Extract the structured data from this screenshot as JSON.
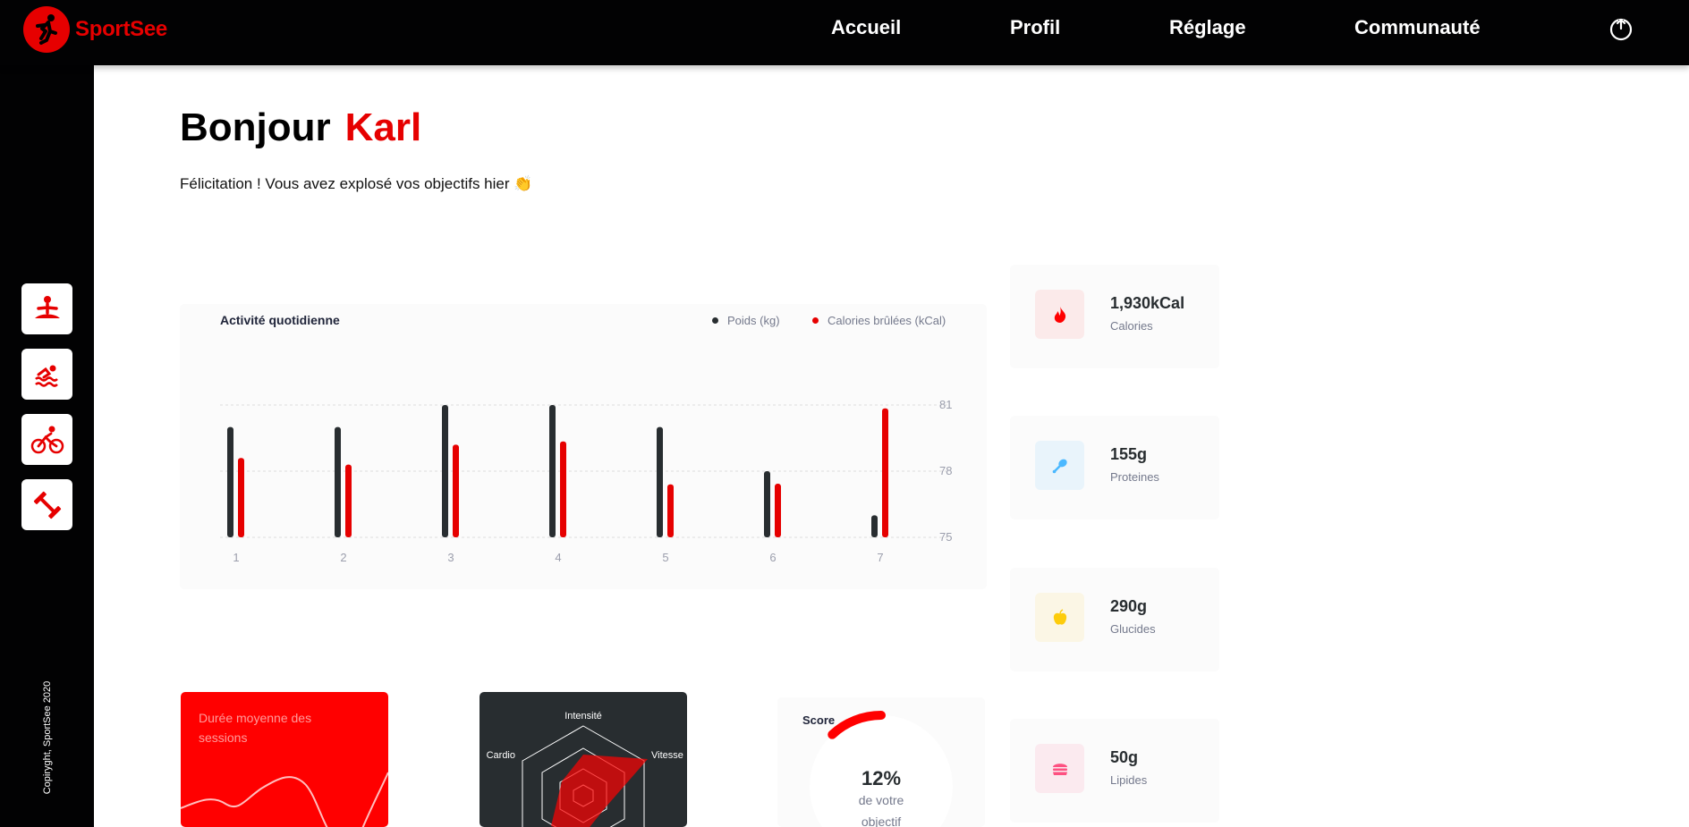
{
  "app": {
    "name": "SportSee"
  },
  "nav": {
    "items": [
      "Accueil",
      "Profil",
      "Réglage",
      "Communauté"
    ]
  },
  "sidebar": {
    "items": [
      {
        "icon": "yoga-icon"
      },
      {
        "icon": "swim-icon"
      },
      {
        "icon": "bike-icon"
      },
      {
        "icon": "dumbbell-icon"
      }
    ],
    "copyright": "Copiryght, SportSee 2020"
  },
  "header": {
    "greeting": "Bonjour",
    "name": "Karl",
    "congrats": "Félicitation ! Vous avez explosé vos objectifs hier 👏"
  },
  "activity": {
    "title": "Activité quotidienne",
    "legend": [
      "Poids (kg)",
      "Calories brûlées (kCal)"
    ],
    "colors": {
      "weight": "#282d30",
      "calories": "#e60000"
    }
  },
  "kpis": [
    {
      "value": "1,930kCal",
      "label": "Calories",
      "icon": "fire-icon",
      "bg": "#fbeaea",
      "color": "#ff0000"
    },
    {
      "value": "155g",
      "label": "Proteines",
      "icon": "chicken-icon",
      "bg": "#e9f4fb",
      "color": "#4ab8ff"
    },
    {
      "value": "290g",
      "label": "Glucides",
      "icon": "apple-icon",
      "bg": "#fbf6e5",
      "color": "#fdcc0c"
    },
    {
      "value": "50g",
      "label": "Lipides",
      "icon": "burger-icon",
      "bg": "#fbeaef",
      "color": "#fd5181"
    }
  ],
  "session": {
    "title": "Durée moyenne des sessions"
  },
  "radar": {
    "labels": [
      "Intensité",
      "Vitesse",
      "Cardio"
    ]
  },
  "score": {
    "title": "Score",
    "percent": "12%",
    "line1": "de votre",
    "line2": "objectif",
    "value": 0.12
  },
  "chart_data": {
    "type": "bar",
    "categories": [
      "1",
      "2",
      "3",
      "4",
      "5",
      "6",
      "7"
    ],
    "series": [
      {
        "name": "Poids (kg)",
        "values": [
          80,
          80,
          81,
          81,
          80,
          78,
          76
        ]
      },
      {
        "name": "Calories brûlées (kCal)",
        "values": [
          240,
          220,
          280,
          290,
          160,
          162,
          390
        ]
      }
    ],
    "y_ticks": [
      75,
      78,
      81
    ],
    "ylim": [
      75,
      81
    ],
    "y2lim": [
      0,
      400
    ],
    "grid": true,
    "legend": "top-right"
  }
}
